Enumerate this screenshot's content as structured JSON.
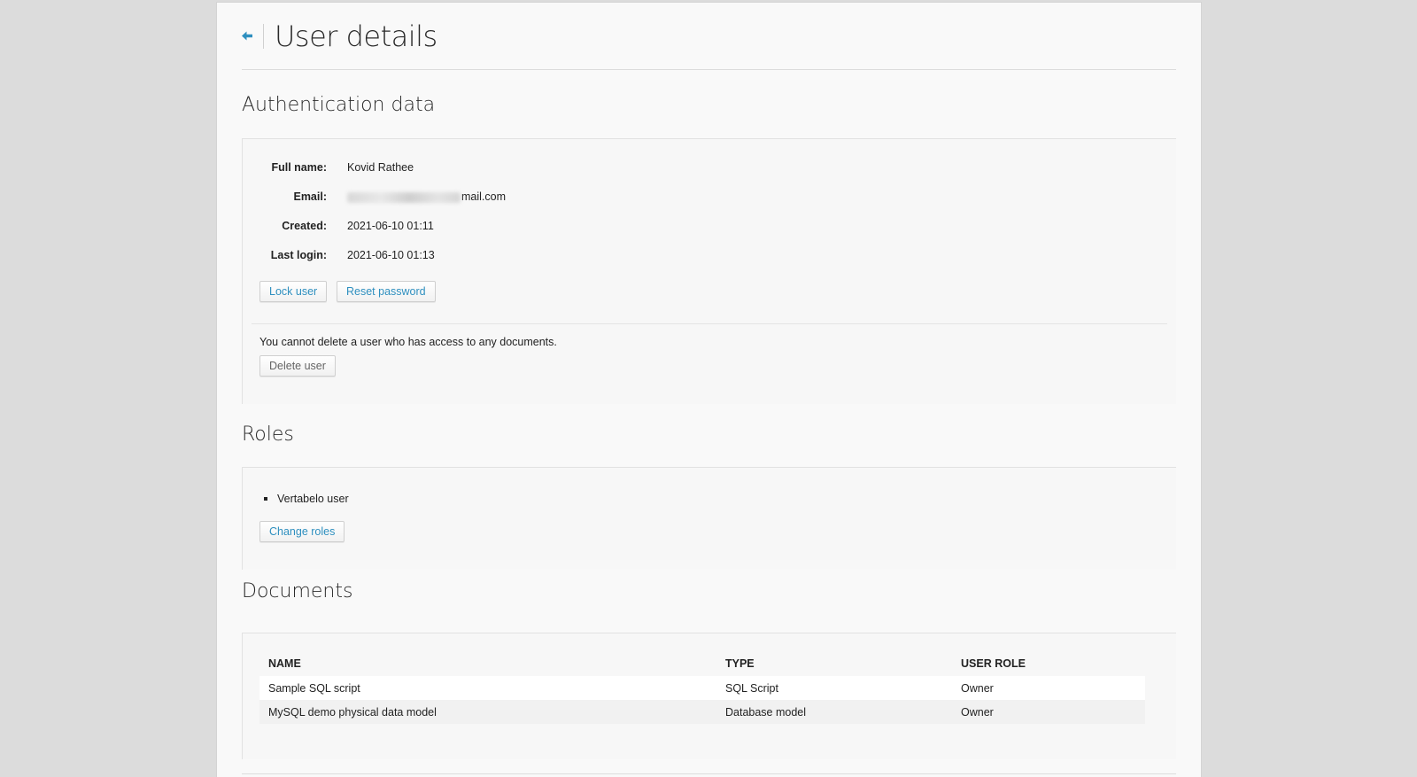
{
  "header": {
    "back_icon": "arrow-left-icon",
    "title": "User details"
  },
  "auth": {
    "title": "Authentication data",
    "full_name_label": "Full name:",
    "full_name": "Kovid Rathee",
    "email_label": "Email:",
    "email_visible_suffix": "mail.com",
    "created_label": "Created:",
    "created": "2021-06-10 01:11",
    "last_login_label": "Last login:",
    "last_login": "2021-06-10 01:13",
    "lock_button": "Lock user",
    "reset_button": "Reset password",
    "delete_notice": "You cannot delete a user who has access to any documents.",
    "delete_button": "Delete user"
  },
  "roles": {
    "title": "Roles",
    "items": [
      "Vertabelo user"
    ],
    "change_button": "Change roles"
  },
  "documents": {
    "title": "Documents",
    "columns": [
      "NAME",
      "TYPE",
      "USER ROLE"
    ],
    "rows": [
      [
        "Sample SQL script",
        "SQL Script",
        "Owner"
      ],
      [
        "MySQL demo physical data model",
        "Database model",
        "Owner"
      ]
    ]
  },
  "colors": {
    "accent": "#2e8fbf",
    "background": "#dcdcdc",
    "panel": "#f9f9f9"
  }
}
